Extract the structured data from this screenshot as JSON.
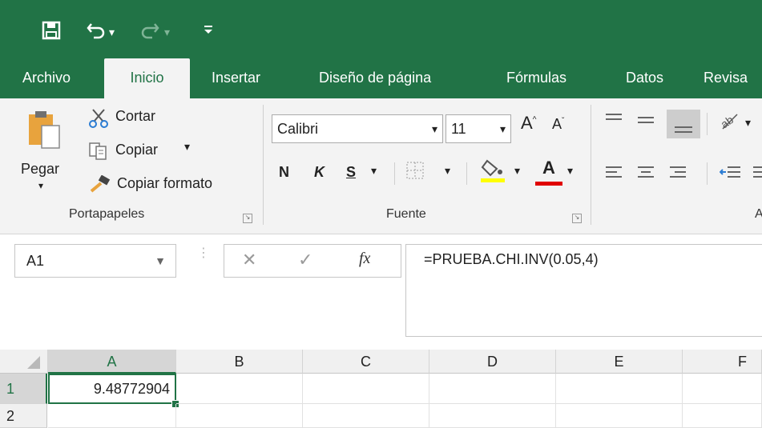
{
  "qat": {
    "save_icon": "save-icon",
    "undo_icon": "undo-icon",
    "redo_icon": "redo-icon",
    "customize_icon": "customize-icon"
  },
  "tabs": [
    {
      "label": "Archivo"
    },
    {
      "label": "Inicio"
    },
    {
      "label": "Insertar"
    },
    {
      "label": "Diseño de página"
    },
    {
      "label": "Fórmulas"
    },
    {
      "label": "Datos"
    },
    {
      "label": "Revisa"
    }
  ],
  "clipboard": {
    "paste_label": "Pegar",
    "cut_label": "Cortar",
    "copy_label": "Copiar",
    "format_painter_label": "Copiar formato",
    "group_label": "Portapapeles"
  },
  "font": {
    "font_name": "Calibri",
    "font_size": "11",
    "bold": "N",
    "italic": "K",
    "underline": "S",
    "increase_size": "A",
    "decrease_size": "A",
    "font_color_letter": "A",
    "group_label": "Fuente"
  },
  "alignment": {
    "group_label_partial": "A"
  },
  "formula_bar": {
    "name_box": "A1",
    "fx_label": "fx",
    "formula": "=PRUEBA.CHI.INV(0.05,4)"
  },
  "sheet": {
    "columns": [
      "A",
      "B",
      "C",
      "D",
      "E",
      "F"
    ],
    "rows": [
      "1",
      "2"
    ],
    "cell_a1": "9.48772904"
  },
  "colors": {
    "accent": "#217346",
    "highlight": "#ffff00",
    "font_color": "#e00000"
  }
}
